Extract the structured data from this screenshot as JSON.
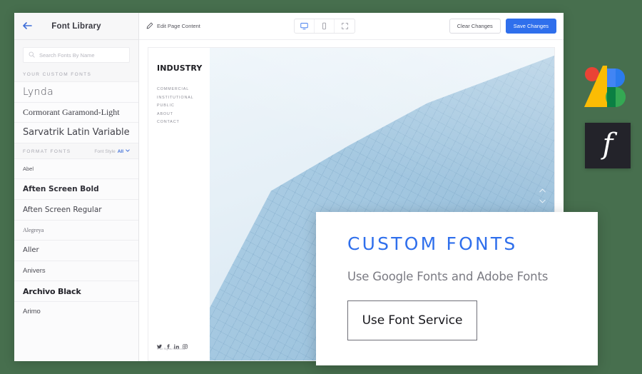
{
  "sidebar": {
    "back_icon": "back-arrow-icon",
    "title": "Font Library",
    "search": {
      "placeholder": "Search Fonts By Name",
      "value": "",
      "icon": "search-icon"
    },
    "custom_section_label": "YOUR CUSTOM FONTS",
    "custom_fonts": [
      {
        "name": "Lynda",
        "style": "f-lynda"
      },
      {
        "name": "Cormorant Garamond-Light",
        "style": "f-cormorant"
      },
      {
        "name": "Sarvatrik Latin Variable",
        "style": "f-sarvatrik"
      }
    ],
    "format_section_label": "FORMAT FONTS",
    "font_style_label": "Font Style",
    "font_style_value": "All",
    "font_style_caret": "chevron-down-icon",
    "format_fonts": [
      {
        "name": "Abel",
        "style": "f-abel"
      },
      {
        "name": "Aften Screen Bold",
        "style": "f-aftenb"
      },
      {
        "name": "Aften Screen Regular",
        "style": "f-aftenr"
      },
      {
        "name": "Alegreya",
        "style": "f-alegreya"
      },
      {
        "name": "Aller",
        "style": "f-aller"
      },
      {
        "name": "Anivers",
        "style": "f-anivers"
      },
      {
        "name": "Archivo Black",
        "style": "f-archivo"
      },
      {
        "name": "Arimo",
        "style": "f-arimo"
      }
    ]
  },
  "toolbar": {
    "edit_icon": "pencil-icon",
    "edit_label": "Edit Page Content",
    "views": [
      {
        "icon": "desktop-icon",
        "active": true
      },
      {
        "icon": "mobile-icon",
        "active": false
      },
      {
        "icon": "fullscreen-icon",
        "active": false
      }
    ],
    "clear_label": "Clear Changes",
    "save_label": "Save Changes",
    "save_color": "#2f6fec"
  },
  "preview": {
    "logo": "INDUSTRY",
    "menu": [
      "COMMERCIAL",
      "INSTITUTIONAL",
      "PUBLIC",
      "ABOUT",
      "CONTACT"
    ],
    "social": [
      "twitter-icon",
      "facebook-icon",
      "linkedin-icon",
      "instagram-icon"
    ],
    "copyright": "© All Rights Reserved",
    "scroll_up_icon": "chevron-up-icon",
    "scroll_down_icon": "chevron-down-icon"
  },
  "card": {
    "title": "CUSTOM FONTS",
    "title_color": "#2f6fec",
    "subtitle": "Use Google Fonts and Adobe Fonts",
    "button_label": "Use Font Service"
  },
  "logos": {
    "google_fonts": "google-fonts-logo",
    "adobe_fonts": "adobe-fonts-logo",
    "adobe_glyph": "f"
  },
  "background_color": "#476f4e"
}
